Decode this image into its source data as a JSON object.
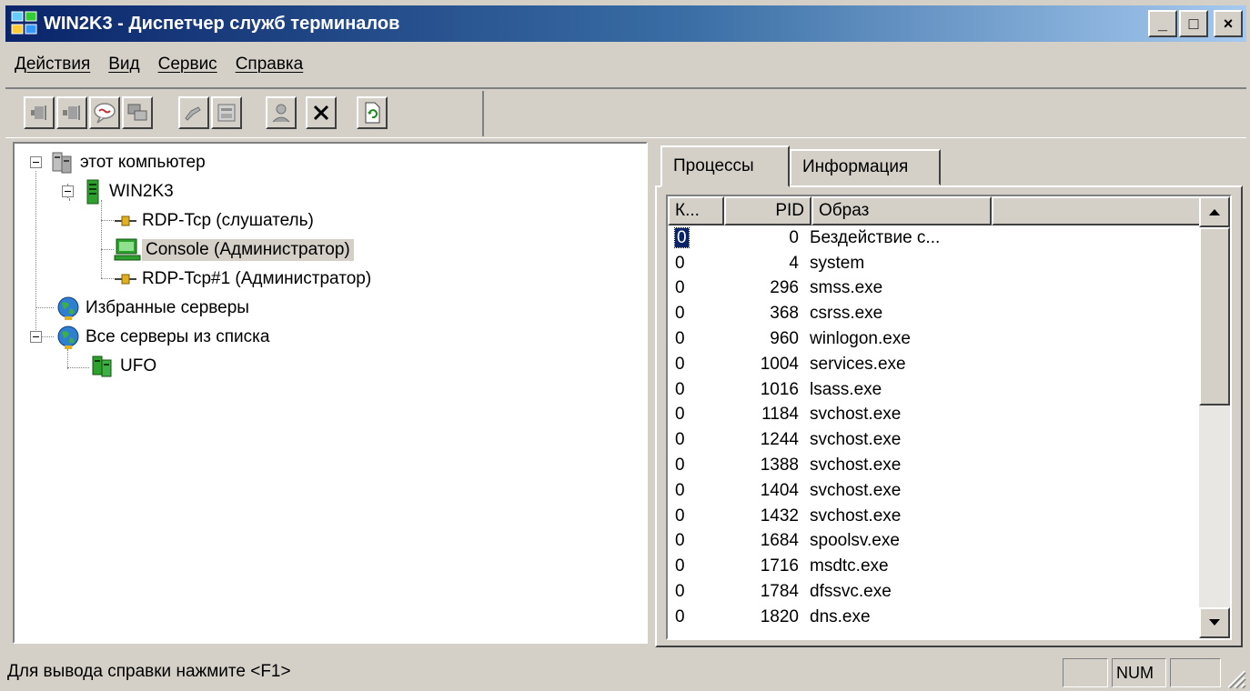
{
  "window": {
    "title": "WIN2K3 - Диспетчер служб терминалов",
    "buttons": {
      "minimize": "_",
      "maximize": "□",
      "close": "×"
    }
  },
  "menu": [
    "Действия",
    "Вид",
    "Сервис",
    "Справка"
  ],
  "toolbar": {
    "buttons": [
      "connect-icon",
      "disconnect-icon",
      "message-icon",
      "remote-control-icon",
      "reset-icon",
      "status-icon",
      "logoff-icon",
      "end-process-icon",
      "refresh-icon"
    ]
  },
  "tree": {
    "this_computer": "этот компьютер",
    "server": "WIN2K3",
    "rdp_listener": "RDP-Tcp (слушатель)",
    "console": "Console (Администратор)",
    "rdp_session": "RDP-Tcp#1 (Администратор)",
    "favorites": "Избранные серверы",
    "all_servers": "Все серверы из списка",
    "ufo": "UFO"
  },
  "tabs": [
    "Процессы",
    "Информация"
  ],
  "processes": {
    "columns": [
      "К...",
      "PID",
      "Образ"
    ],
    "rows": [
      {
        "k": "0",
        "pid": "0",
        "image": "Бездействие с..."
      },
      {
        "k": "0",
        "pid": "4",
        "image": "system"
      },
      {
        "k": "0",
        "pid": "296",
        "image": "smss.exe"
      },
      {
        "k": "0",
        "pid": "368",
        "image": "csrss.exe"
      },
      {
        "k": "0",
        "pid": "960",
        "image": "winlogon.exe"
      },
      {
        "k": "0",
        "pid": "1004",
        "image": "services.exe"
      },
      {
        "k": "0",
        "pid": "1016",
        "image": "lsass.exe"
      },
      {
        "k": "0",
        "pid": "1184",
        "image": "svchost.exe"
      },
      {
        "k": "0",
        "pid": "1244",
        "image": "svchost.exe"
      },
      {
        "k": "0",
        "pid": "1388",
        "image": "svchost.exe"
      },
      {
        "k": "0",
        "pid": "1404",
        "image": "svchost.exe"
      },
      {
        "k": "0",
        "pid": "1432",
        "image": "svchost.exe"
      },
      {
        "k": "0",
        "pid": "1684",
        "image": "spoolsv.exe"
      },
      {
        "k": "0",
        "pid": "1716",
        "image": "msdtc.exe"
      },
      {
        "k": "0",
        "pid": "1784",
        "image": "dfssvc.exe"
      },
      {
        "k": "0",
        "pid": "1820",
        "image": "dns.exe"
      }
    ]
  },
  "status": {
    "text": "Для вывода справки нажмите <F1>",
    "num": "NUM"
  },
  "colors": {
    "titlebar": "#0a246a",
    "face": "#d4d0c8",
    "selection": "#0a246a"
  }
}
